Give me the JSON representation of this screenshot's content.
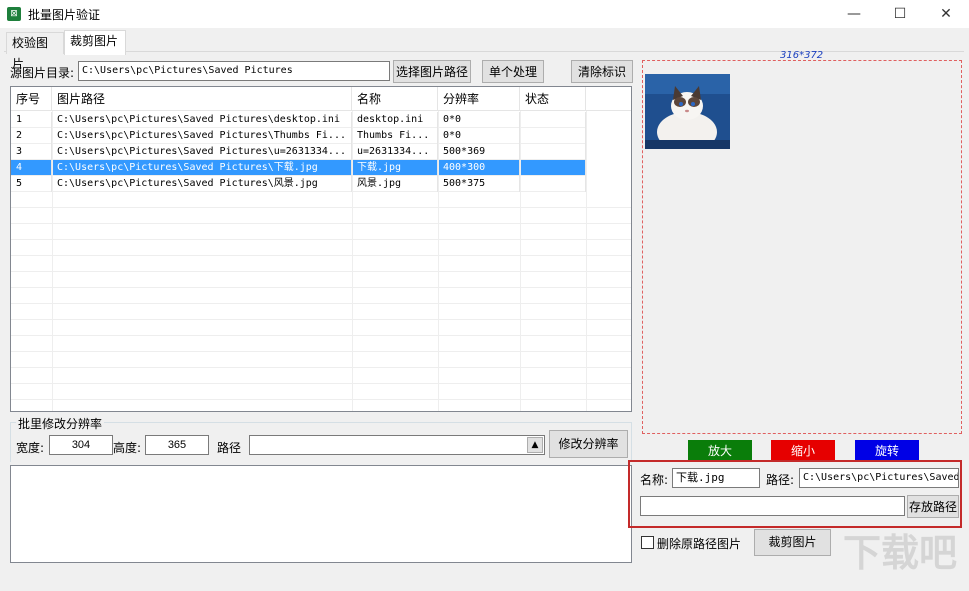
{
  "window": {
    "title": "批量图片验证",
    "icon_text": "⊠",
    "minimize": "—",
    "maximize": "☐",
    "close": "✕"
  },
  "tabs": [
    {
      "label": "校验图片"
    },
    {
      "label": "裁剪图片"
    }
  ],
  "source": {
    "label": "源图片目录:",
    "value": "C:\\Users\\pc\\Pictures\\Saved Pictures"
  },
  "buttons": {
    "select_path": "选择图片路径",
    "single": "单个处理",
    "clear": "清除标识",
    "modify_res": "修改分辨率",
    "crop": "裁剪图片",
    "save_path": "存放路径",
    "zoom_in": "放大",
    "zoom_out": "缩小",
    "rotate": "旋转"
  },
  "table": {
    "headers": [
      "序号",
      "图片路径",
      "名称",
      "分辨率",
      "状态"
    ],
    "rows": [
      {
        "no": "1",
        "path": "C:\\Users\\pc\\Pictures\\Saved Pictures\\desktop.ini",
        "name": "desktop.ini",
        "res": "0*0",
        "status": ""
      },
      {
        "no": "2",
        "path": "C:\\Users\\pc\\Pictures\\Saved Pictures\\Thumbs Fi...",
        "name": "Thumbs Fi...",
        "res": "0*0",
        "status": ""
      },
      {
        "no": "3",
        "path": "C:\\Users\\pc\\Pictures\\Saved Pictures\\u=2631334...",
        "name": "u=2631334...",
        "res": "500*369",
        "status": ""
      },
      {
        "no": "4",
        "path": "C:\\Users\\pc\\Pictures\\Saved Pictures\\下载.jpg",
        "name": "下载.jpg",
        "res": "400*300",
        "status": ""
      },
      {
        "no": "5",
        "path": "C:\\Users\\pc\\Pictures\\Saved Pictures\\风景.jpg",
        "name": "风景.jpg",
        "res": "500*375",
        "status": ""
      }
    ],
    "selected_index": 3
  },
  "batch": {
    "group_label": "批里修改分辨率",
    "width_label": "宽度:",
    "width_value": "304",
    "height_label": "高度:",
    "height_value": "365",
    "path_label": "路径",
    "path_value": ""
  },
  "preview": {
    "size_label": "316*372"
  },
  "output": {
    "name_label": "名称:",
    "name_value": "下载.jpg",
    "path_label": "路径:",
    "path_value": "C:\\Users\\pc\\Pictures\\Saved",
    "save_path_value": ""
  },
  "delete_original": {
    "label": "删除原路径图片",
    "checked": false
  },
  "colors": {
    "zoom_in": "#0a7d0a",
    "zoom_out": "#e60000",
    "rotate": "#0000e6",
    "selection": "#3399ff",
    "highlight": "#c42a2a"
  },
  "watermark": {
    "text": "下载吧"
  }
}
